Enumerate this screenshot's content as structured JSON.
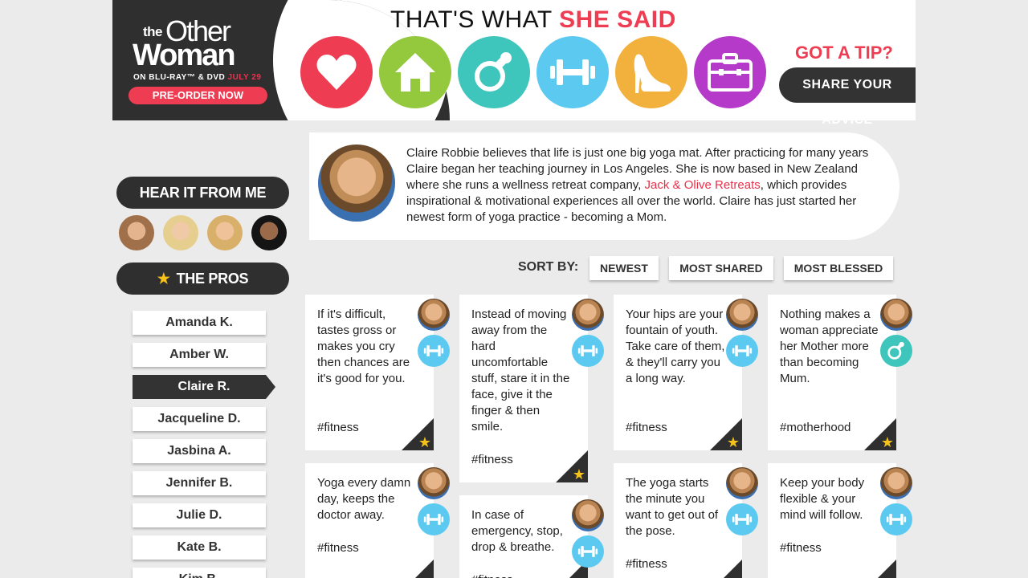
{
  "promo": {
    "logo_the": "the",
    "logo_other": "Other",
    "logo_woman": "Woman",
    "release_prefix": "ON BLU-RAY™ & DVD",
    "release_date": "JULY 29",
    "preorder_label": "PRE-ORDER NOW"
  },
  "header": {
    "tagline_plain": "THAT'S WHAT ",
    "tagline_highlight": "SHE SAID",
    "categories": [
      {
        "name": "love",
        "icon": "heart-icon",
        "color": "#ee3d52"
      },
      {
        "name": "home",
        "icon": "house-icon",
        "color": "#94c83d"
      },
      {
        "name": "motherhood",
        "icon": "pacifier-icon",
        "color": "#3ec5bc"
      },
      {
        "name": "fitness",
        "icon": "dumbbell-icon",
        "color": "#5cc9f0"
      },
      {
        "name": "fashion",
        "icon": "high-heel-icon",
        "color": "#f2b13c"
      },
      {
        "name": "career",
        "icon": "briefcase-icon",
        "color": "#b53ac9"
      }
    ],
    "tip_title": "GOT A TIP?",
    "share_label": "SHARE YOUR ADVICE"
  },
  "bio": {
    "text_before": "Claire Robbie believes that life is just one big yoga mat. After practicing for many years Claire began her teaching journey in Los Angeles. She is now based in New Zealand where she runs a wellness retreat company, ",
    "link": "Jack & Olive Retreats",
    "text_after": ", which provides inspirational & motivational experiences all over the world. Claire has just started her newest form of yoga practice - becoming a Mom."
  },
  "sidebar": {
    "hear_label": "HEAR IT FROM ME",
    "pros_label": "THE PROS",
    "pros": [
      "Amanda K.",
      "Amber W.",
      "Claire R.",
      "Jacqueline D.",
      "Jasbina A.",
      "Jennifer B.",
      "Julie D.",
      "Kate B.",
      "Kim B."
    ],
    "active_pro": "Claire R."
  },
  "sort": {
    "label": "SORT BY:",
    "options": [
      "NEWEST",
      "MOST SHARED",
      "MOST BLESSED"
    ]
  },
  "tips": [
    {
      "text": "If it's difficult, tastes gross or makes you cry then chances are it's good for you.",
      "tag": "#fitness",
      "category": "fitness"
    },
    {
      "text": "Instead of moving away from the hard uncomfortable stuff, stare it in the face, give it the finger & then smile.",
      "tag": "#fitness",
      "category": "fitness"
    },
    {
      "text": "Your hips are your fountain of youth. Take care of them, & they'll carry you a long way.",
      "tag": "#fitness",
      "category": "fitness"
    },
    {
      "text": "Nothing makes a woman appreciate her Mother more than becoming Mum.",
      "tag": "#motherhood",
      "category": "motherhood"
    },
    {
      "text": "Yoga every damn day, keeps the doctor away.",
      "tag": "#fitness",
      "category": "fitness"
    },
    {
      "text": "In case of emergency, stop, drop & breathe.",
      "tag": "#fitness",
      "category": "fitness"
    },
    {
      "text": "The yoga starts the minute you want to get out of the pose.",
      "tag": "#fitness",
      "category": "fitness"
    },
    {
      "text": "Keep your body flexible & your mind will follow.",
      "tag": "#fitness",
      "category": "fitness"
    }
  ]
}
